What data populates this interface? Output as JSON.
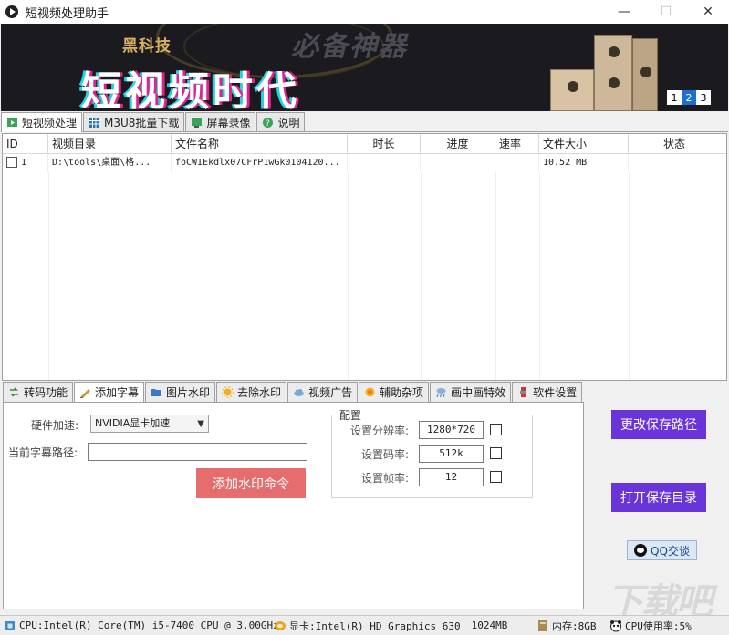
{
  "window": {
    "title": "短视频处理助手",
    "minimize": "—",
    "maximize": "☐",
    "close": "✕"
  },
  "banner": {
    "subtitle": "黑科技",
    "background_text": "必备神器",
    "headline": "短视频时代",
    "pages": [
      "1",
      "2",
      "3"
    ],
    "active_page": "2"
  },
  "top_tabs": [
    {
      "label": "短视频处理",
      "icon": "video-icon",
      "active": true
    },
    {
      "label": "M3U8批量下载",
      "icon": "grid-icon",
      "active": false
    },
    {
      "label": "屏幕录像",
      "icon": "screen-icon",
      "active": false
    },
    {
      "label": "说明",
      "icon": "help-icon",
      "active": false
    }
  ],
  "table": {
    "columns": [
      "ID",
      "视频目录",
      "文件名称",
      "时长",
      "进度",
      "速率",
      "文件大小",
      "状态"
    ],
    "rows": [
      {
        "id": "1",
        "dir": "D:\\tools\\桌面\\格...",
        "name": "foCWIEkdlx07CFrP1wGk0104120...",
        "duration": "",
        "progress": "",
        "rate": "",
        "size": "10.52 MB",
        "status": ""
      }
    ]
  },
  "bottom_tabs": [
    {
      "label": "转码功能",
      "icon": "transcode-icon",
      "active": false
    },
    {
      "label": "添加字幕",
      "icon": "subtitle-icon",
      "active": true
    },
    {
      "label": "图片水印",
      "icon": "image-icon",
      "active": false
    },
    {
      "label": "去除水印",
      "icon": "sun-icon",
      "active": false
    },
    {
      "label": "视频广告",
      "icon": "cloud-icon",
      "active": false
    },
    {
      "label": "辅助杂项",
      "icon": "badge-icon",
      "active": false
    },
    {
      "label": "画中画特效",
      "icon": "rain-icon",
      "active": false
    },
    {
      "label": "软件设置",
      "icon": "settings-icon",
      "active": false
    }
  ],
  "subtitle_panel": {
    "hw_accel_label": "硬件加速:",
    "hw_accel_value": "NVIDIA显卡加速",
    "path_label": "当前字幕路径:",
    "path_value": "",
    "add_button": "添加水印命令",
    "config_title": "配置",
    "resolution_label": "设置分辨率:",
    "resolution_value": "1280*720",
    "bitrate_label": "设置码率:",
    "bitrate_value": "512k",
    "fps_label": "设置帧率:",
    "fps_value": "12"
  },
  "right_panel": {
    "change_path": "更改保存路径",
    "open_dir": "打开保存目录",
    "qq": "QQ交谈"
  },
  "status": {
    "cpu": "CPU:Intel(R) Core(TM) i5-7400 CPU @ 3.00GHz",
    "gpu": "显卡:Intel(R) HD Graphics 630",
    "vram": "1024MB",
    "mem": "内存:8GB",
    "cpu_usage": "CPU使用率:5%"
  },
  "watermark_text": "下载吧",
  "colors": {
    "purple_button": "#6935d8",
    "red_button": "#e56d6d",
    "banner_bg": "#1b1b1f",
    "pager_active": "#1e6fd0"
  }
}
